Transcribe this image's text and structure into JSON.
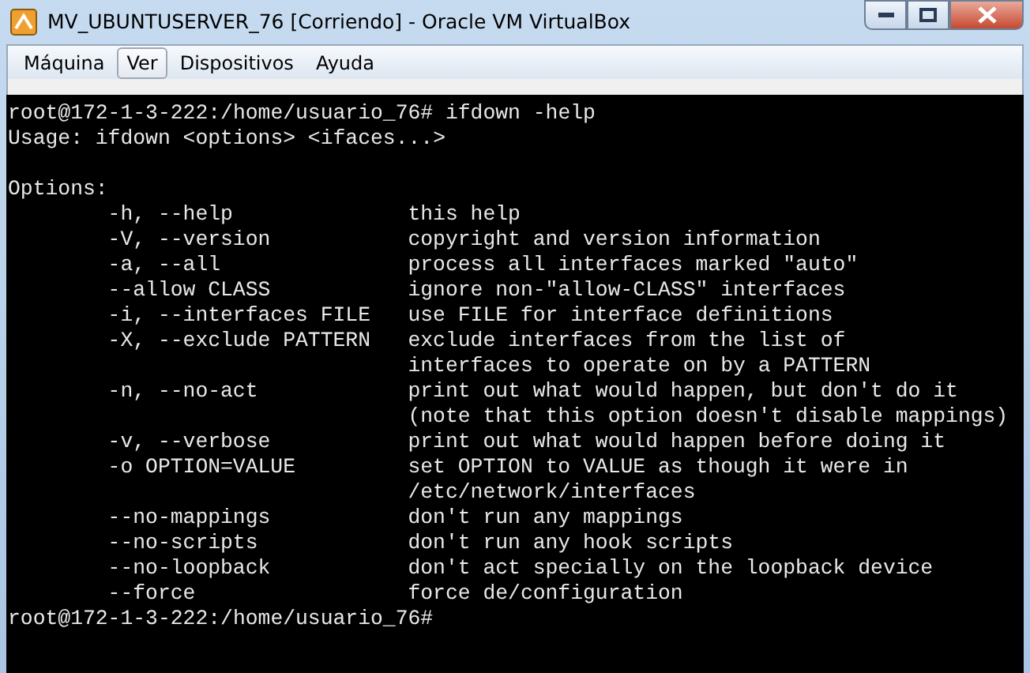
{
  "window": {
    "title": "MV_UBUNTUSERVER_76 [Corriendo] - Oracle VM VirtualBox"
  },
  "menu": [
    {
      "label": "Máquina",
      "selected": false
    },
    {
      "label": "Ver",
      "selected": true
    },
    {
      "label": "Dispositivos",
      "selected": false
    },
    {
      "label": "Ayuda",
      "selected": false
    }
  ],
  "terminal": {
    "lines": [
      {
        "kind": "text",
        "text": "root@172-1-3-222:/home/usuario_76# ifdown -help"
      },
      {
        "kind": "text",
        "text": "Usage: ifdown <options> <ifaces...>"
      },
      {
        "kind": "blank"
      },
      {
        "kind": "text",
        "text": "Options:"
      },
      {
        "kind": "option",
        "option": "-h, --help",
        "description": "this help"
      },
      {
        "kind": "option",
        "option": "-V, --version",
        "description": "copyright and version information"
      },
      {
        "kind": "option",
        "option": "-a, --all",
        "description": "process all interfaces marked \"auto\""
      },
      {
        "kind": "option",
        "option": "--allow CLASS",
        "description": "ignore non-\"allow-CLASS\" interfaces"
      },
      {
        "kind": "option",
        "option": "-i, --interfaces FILE",
        "description": "use FILE for interface definitions"
      },
      {
        "kind": "option",
        "option": "-X, --exclude PATTERN",
        "description": "exclude interfaces from the list of"
      },
      {
        "kind": "continuation",
        "description": "interfaces to operate on by a PATTERN"
      },
      {
        "kind": "option",
        "option": "-n, --no-act",
        "description": "print out what would happen, but don't do it"
      },
      {
        "kind": "continuation",
        "description": "(note that this option doesn't disable mappings)"
      },
      {
        "kind": "option",
        "option": "-v, --verbose",
        "description": "print out what would happen before doing it"
      },
      {
        "kind": "option",
        "option": "-o OPTION=VALUE",
        "description": "set OPTION to VALUE as though it were in"
      },
      {
        "kind": "continuation",
        "description": "/etc/network/interfaces"
      },
      {
        "kind": "option",
        "option": "--no-mappings",
        "description": "don't run any mappings"
      },
      {
        "kind": "option",
        "option": "--no-scripts",
        "description": "don't run any hook scripts"
      },
      {
        "kind": "option",
        "option": "--no-loopback",
        "description": "don't act specially on the loopback device"
      },
      {
        "kind": "option",
        "option": "--force",
        "description": "force de/configuration"
      },
      {
        "kind": "text",
        "text": "root@172-1-3-222:/home/usuario_76#"
      }
    ]
  }
}
